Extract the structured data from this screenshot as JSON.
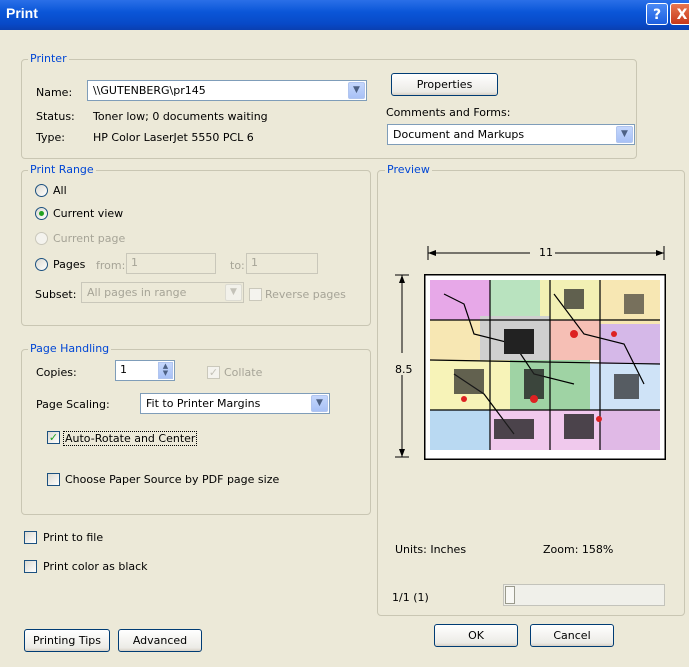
{
  "window": {
    "title": "Print",
    "help_glyph": "?",
    "close_glyph": "X"
  },
  "printer": {
    "legend": "Printer",
    "name_label": "Name:",
    "name_value": "\\\\GUTENBERG\\pr145",
    "status_label": "Status:",
    "status_value": "Toner low; 0 documents waiting",
    "type_label": "Type:",
    "type_value": "HP Color LaserJet 5550 PCL 6",
    "properties_button": "Properties",
    "comments_label": "Comments and Forms:",
    "comments_value": "Document and Markups"
  },
  "print_range": {
    "legend": "Print Range",
    "all": "All",
    "current_view": "Current view",
    "current_page": "Current page",
    "pages": "Pages",
    "from_label": "from:",
    "from_value": "1",
    "to_label": "to:",
    "to_value": "1",
    "subset_label": "Subset:",
    "subset_value": "All pages in range",
    "reverse_pages": "Reverse pages",
    "selected": "current_view"
  },
  "page_handling": {
    "legend": "Page Handling",
    "copies_label": "Copies:",
    "copies_value": "1",
    "collate": "Collate",
    "scaling_label": "Page Scaling:",
    "scaling_value": "Fit to Printer Margins",
    "auto_rotate": "Auto-Rotate and Center",
    "auto_rotate_checked": true,
    "paper_source": "Choose Paper Source by PDF page size",
    "paper_source_checked": false
  },
  "options": {
    "print_to_file": "Print to file",
    "print_color_black": "Print color as black"
  },
  "preview": {
    "legend": "Preview",
    "width_label": "11",
    "height_label": "8.5",
    "units": "Units: Inches",
    "zoom": "Zoom: 158%",
    "page_indicator": "1/1 (1)",
    "slider_fraction": 0
  },
  "buttons": {
    "tips": "Printing Tips",
    "advanced": "Advanced",
    "ok": "OK",
    "cancel": "Cancel"
  },
  "colors": {
    "title_bar": "#0a56d8",
    "dialog_bg": "#ECE9D8",
    "legend_text": "#0046d5",
    "check_green": "#21a121"
  },
  "icons": {
    "dropdown": "chevron-down-icon",
    "spinner": "spin-up-down-icon",
    "check": "checkmark-icon"
  }
}
